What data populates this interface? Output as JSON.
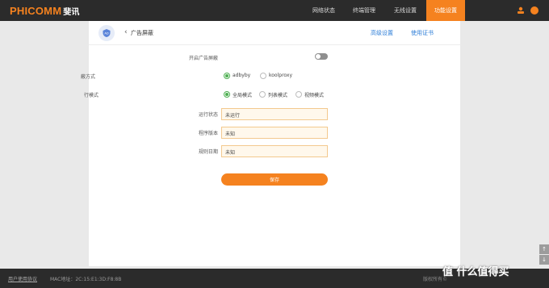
{
  "header": {
    "logo_text": "PHICOMM",
    "logo_cn": "斐讯",
    "nav": [
      "网络状态",
      "终端管理",
      "无线设置",
      "功能设置"
    ],
    "active_nav": "功能设置"
  },
  "panel": {
    "title": "广告屏蔽",
    "links": {
      "advanced": "高级设置",
      "license": "使用证书"
    }
  },
  "form": {
    "enable_label": "开启广告屏蔽",
    "enabled": false,
    "method_label": "蔽方式",
    "method_options": [
      "adbyby",
      "koolproxy"
    ],
    "method_selected": "adbyby",
    "mode_label": "行模式",
    "mode_options": [
      "全局模式",
      "列表模式",
      "视频模式"
    ],
    "mode_selected": "全局模式",
    "status_label": "运行状态",
    "status_value": "未运行",
    "version_label": "程序版本",
    "version_value": "未知",
    "rule_date_label": "规则日期",
    "rule_date_value": "未知",
    "save_label": "保存"
  },
  "side_buttons": [
    "↑",
    "↓"
  ],
  "footer": {
    "user_agreement": "用户使用协议",
    "mac": "MAC地址：2C:15:E1:3D:F8:8B",
    "copyright": "版权所有©"
  },
  "watermark": "值 什么值得买",
  "colors": {
    "accent": "#f5821f",
    "radio_active": "#4caf50",
    "link": "#2f7fd8"
  }
}
